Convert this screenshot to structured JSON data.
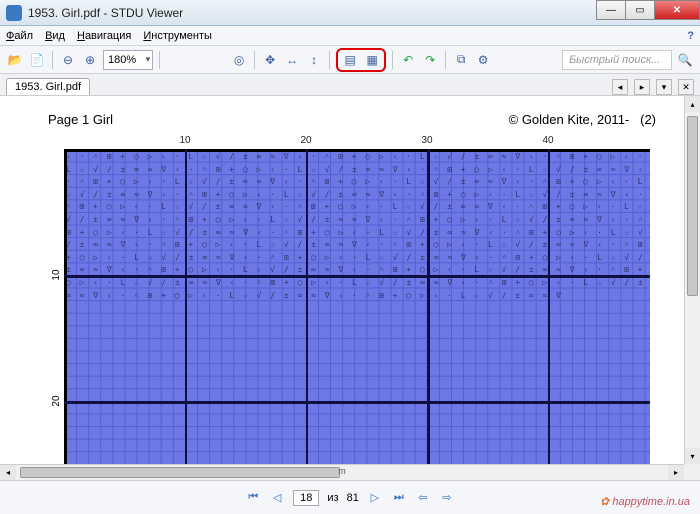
{
  "window": {
    "title": "1953. Girl.pdf - STDU Viewer"
  },
  "menu": {
    "file": "Файл",
    "view": "Вид",
    "nav": "Навигация",
    "tools": "Инструменты"
  },
  "toolbar": {
    "zoom": "180%",
    "search_placeholder": "Быстрый поиск..."
  },
  "tab": {
    "name": "1953. Girl.pdf"
  },
  "page": {
    "left": "Page 1  Girl",
    "right_a": "© Golden Kite, 2011-",
    "right_b": "(2)"
  },
  "cols": {
    "c10": "10",
    "c20": "20",
    "c30": "30",
    "c40": "40"
  },
  "rows": {
    "r10": "10",
    "r20": "20"
  },
  "hscroll_mid": "m",
  "status": {
    "page": "18",
    "sep": "из",
    "total": "81"
  },
  "watermark": "happytime.in.ua",
  "symfill": "‹ · ˄ ⊞ + ◯ ▷ ‹ · L ☆ √ ∕ ± ∞ ≈ ∇ ‹ · ˄ ⊞ + ◯ ▷ ‹ · L ☆ √ ∕ ± ∞ ≈ ∇ ‹ · ˄ ⊞ + ◯ ▷ ‹ · L ☆ √ ∕ ± ∞ ≈ ∇ ‹ · ˄ ⊞ + ◯ ▷ ‹ · L ☆ √ ∕ ± ∞ ≈ ∇ ‹ · ˄ ⊞ + ◯ ▷ ‹ · L ☆ √ ∕ ± ∞ ≈ ∇ ‹ · ˄ ⊞ + ◯ ▷ ‹ · L ☆ √ ∕ ± ∞ ≈ ∇ ‹ · ˄ ⊞ + ◯ ▷ ‹ · L ☆ √ ∕ ± ∞ ≈ ∇ ‹ · ˄ ⊞ + ◯ ▷ ‹ · L ☆ √ ∕ ± ∞ ≈ ∇ ‹ · ˄ ⊞ + ◯ ▷ ‹ · L ☆ √ ∕ ± ∞ ≈ ∇ ‹ · ˄ ⊞ + ◯ ▷ ‹ · L ☆ √ ∕ ± ∞ ≈ ∇ ‹ · ˄ ⊞ + ◯ ▷ ‹ · L ☆ √ ∕ ± ∞ ≈ ∇ ‹ · ˄ ⊞ + ◯ ▷ ‹ · L ☆ √ ∕ ± ∞ ≈ ∇ ‹ · ˄ ⊞ + ◯ ▷ ‹ · L ☆ √ ∕ ± ∞ ≈ ∇ ‹ · ˄ ⊞ + ◯ ▷ ‹ · L ☆ √ ∕ ± ∞ ≈ ∇ ‹ · ˄ ⊞ + ◯ ▷ ‹ · L ☆ √ ∕ ± ∞ ≈ ∇ ‹ · ˄ ⊞ + ◯ ▷ ‹ · L ☆ √ ∕ ± ∞ ≈ ∇ ‹ · ˄ ⊞ + ◯ ▷ ‹ · L ☆ √ ∕ ± ∞ ≈ ∇ ‹ · ˄ ⊞ + ◯ ▷ ‹ · L ☆ √ ∕ ± ∞ ≈ ∇ ‹ · ˄ ⊞ + ◯ ▷ ‹ · L ☆ √ ∕ ± ∞ ≈ ∇ ‹ · ˄ ⊞ + ◯ ▷ ‹ · L ☆ √ ∕ ± ∞ ≈ ∇ ‹ · ˄ ⊞ + ◯ ▷ ‹ · L ☆ √ ∕ ± ∞ ≈ ∇ ‹ · ˄ ⊞ + ◯ ▷ ‹ · L ☆ √ ∕ ± ∞ ≈ ∇ ‹ · ˄ ⊞ + ◯ ▷ ‹ · L ☆ √ ∕ ± ∞ ≈ ∇ ‹ · ˄ ⊞ + ◯ ▷ ‹ · L ☆ √ ∕ ± ∞ ≈ ∇ ‹ · ˄ ⊞ + ◯ ▷ ‹ · L ☆ √ ∕ ± ∞ ≈ ∇ ‹ · ˄ ⊞ + ◯ ▷ ‹ · L ☆ √ ∕ ± ∞ ≈ ∇ ‹ · ˄ ⊞ + ◯ ▷ ‹ · L ☆ √ ∕ ± ∞ ≈ ∇ ‹ · ˄ ⊞ + ◯ ▷ ‹ · L ☆ √ ∕ ± ∞ ≈ ∇ ‹ · ˄ ⊞ + ◯ ▷ ‹ · L ☆ √ ∕ ± ∞ ≈ ∇ ‹ · ˄ ⊞ + ◯ ▷ ‹ · L ☆ √ ∕ ± ∞ ≈ ∇"
}
